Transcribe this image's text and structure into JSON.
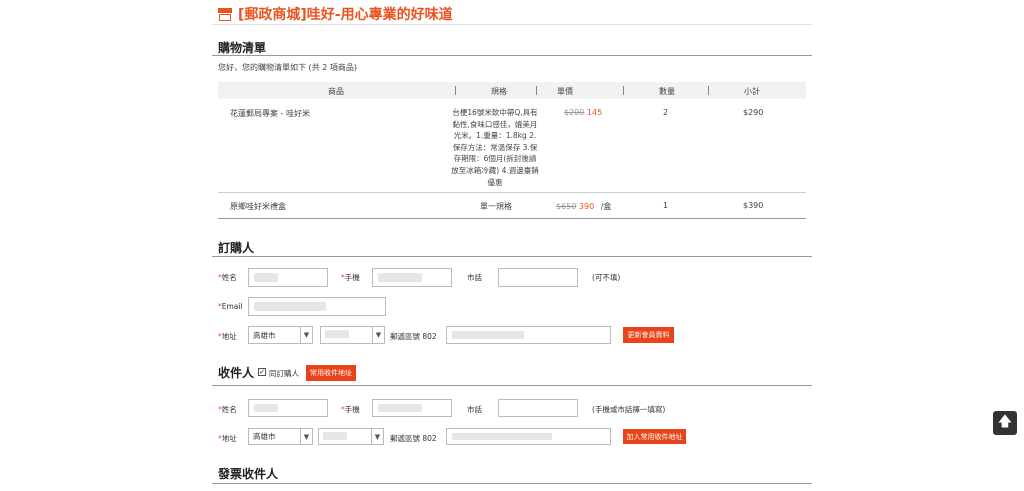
{
  "header": {
    "title": "[郵政商城]哇好-用心專業的好味道",
    "icon": "shop-icon"
  },
  "cart": {
    "section_title": "購物清單",
    "greeting": "您好，您的購物清單如下 (共 2 項商品)",
    "columns": [
      "商品",
      "規格",
      "單價",
      "數量",
      "小計"
    ],
    "rows": [
      {
        "name": "花蓮郵局專案 - 哇好米",
        "spec": "台梗16號米軟中帶Q,具有黏性,食味口感佳，媲美月光米。1.重量：1.8kg 2.保存方法：常溫保存 3.保存期限：6個月(拆封後請放至冰箱冷藏) 4.週邊臺銷優惠",
        "orig_price": "$200",
        "price": "145",
        "unit": "",
        "qty": "2",
        "subtotal": "$290"
      },
      {
        "name": "原鄉哇好米禮盒",
        "spec": "單一規格",
        "orig_price": "$650",
        "price": "390",
        "unit": "/盒",
        "qty": "1",
        "subtotal": "$390"
      }
    ]
  },
  "buyer": {
    "section_title": "訂購人",
    "name_label": "姓名",
    "mobile_label": "手機",
    "phone_label": "市話",
    "phone_hint": "(可不填)",
    "email_label": "Email",
    "address_label": "地址",
    "city": "高雄市",
    "zip_label": "郵遞區號",
    "zip": "802",
    "update_button": "更新會員資料"
  },
  "receiver": {
    "section_title": "收件人",
    "same_label": "同訂購人",
    "same_checked": "✓",
    "common_button": "常用收件地址",
    "name_label": "姓名",
    "mobile_label": "手機",
    "phone_label": "市話",
    "phone_hint": "(手機或市話擇一填寫)",
    "address_label": "地址",
    "city": "高雄市",
    "zip_label": "郵遞區號",
    "zip": "802",
    "add_button": "加入常用收件地址"
  },
  "invoice": {
    "section_title": "發票收件人"
  },
  "scroll_top": {
    "icon": "arrow-up-icon",
    "glyph": "🡅"
  }
}
